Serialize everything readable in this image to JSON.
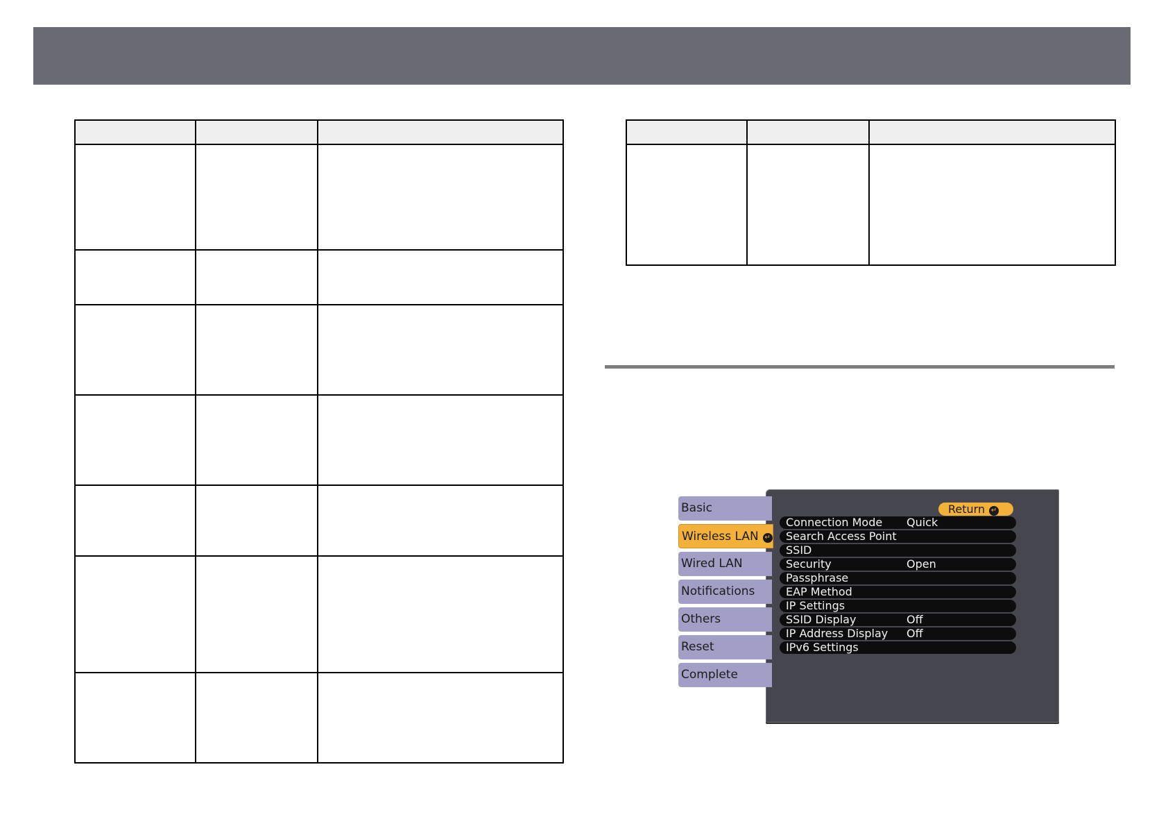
{
  "colors": {
    "header_bar": "#696c75",
    "table_header_fill": "#efefef",
    "menu_tab": "#a19fc6",
    "menu_tab_active": "#f3b13a",
    "menu_panel": "#46474e",
    "menu_row": "#0d0d0d"
  },
  "left_table": {
    "columns": 3,
    "body_rows": 7
  },
  "right_table": {
    "columns": 3,
    "body_rows": 1
  },
  "menu": {
    "tabs": [
      {
        "label": "Basic",
        "active": false
      },
      {
        "label": "Wireless LAN",
        "active": true
      },
      {
        "label": "Wired LAN",
        "active": false
      },
      {
        "label": "Notifications",
        "active": false
      },
      {
        "label": "Others",
        "active": false
      },
      {
        "label": "Reset",
        "active": false
      },
      {
        "label": "Complete",
        "active": false
      }
    ],
    "return_label": "Return",
    "enter_icon": "enter-icon",
    "rows": [
      {
        "label": "Connection Mode",
        "value": "Quick"
      },
      {
        "label": "Search Access Point",
        "value": ""
      },
      {
        "label": "SSID",
        "value": ""
      },
      {
        "label": "Security",
        "value": "Open"
      },
      {
        "label": "Passphrase",
        "value": ""
      },
      {
        "label": "EAP Method",
        "value": ""
      },
      {
        "label": "IP Settings",
        "value": ""
      },
      {
        "label": "SSID Display",
        "value": "Off"
      },
      {
        "label": "IP Address Display",
        "value": "Off"
      },
      {
        "label": "IPv6 Settings",
        "value": ""
      }
    ]
  }
}
